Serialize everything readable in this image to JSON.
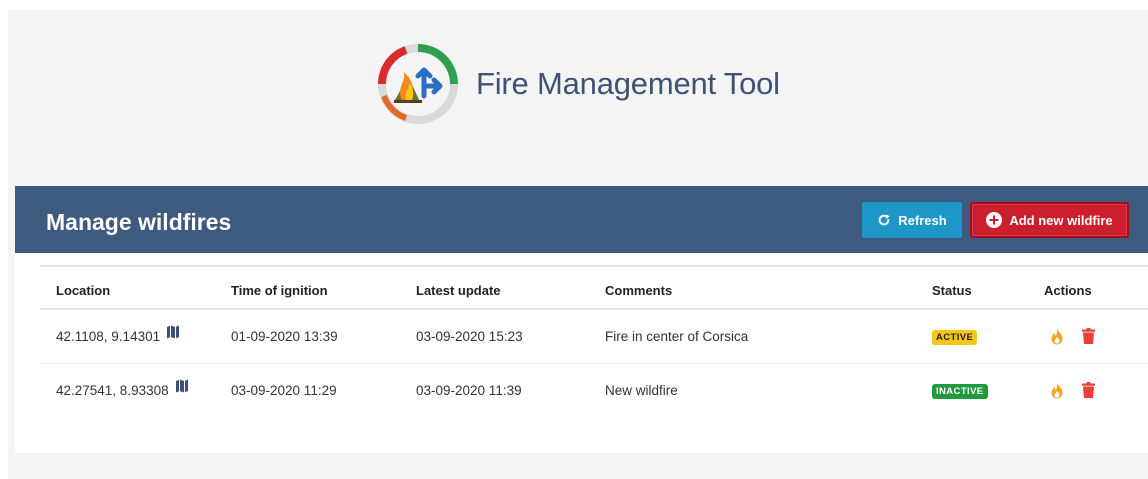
{
  "app": {
    "title": "Fire Management Tool"
  },
  "panel": {
    "title": "Manage wildfires",
    "refresh_label": "Refresh",
    "add_label": "Add new wildfire"
  },
  "table": {
    "headers": [
      "Location",
      "Time of ignition",
      "Latest update",
      "Comments",
      "Status",
      "Actions"
    ],
    "rows": [
      {
        "location": "42.1108, 9.14301",
        "ignition": "01-09-2020 13:39",
        "update": "03-09-2020 15:23",
        "comment": "Fire in center of Corsica",
        "status": "ACTIVE"
      },
      {
        "location": "42.27541, 8.93308",
        "ignition": "03-09-2020 11:29",
        "update": "03-09-2020 11:39",
        "comment": "New wildfire",
        "status": "INACTIVE"
      }
    ]
  },
  "icons": {
    "refresh": "refresh-icon",
    "add": "plus-circle-icon",
    "map": "map-icon",
    "fire": "fire-icon",
    "delete": "trash-icon"
  },
  "colors": {
    "header_bar": "#3f5a7f",
    "title": "#3f5273",
    "refresh_button": "#1e96c8",
    "add_button": "#cc1f2e",
    "active_badge": "#f5c518",
    "inactive_badge": "#1f9a3d",
    "fire_icon": "#f5a623",
    "delete_icon": "#e8403a"
  }
}
